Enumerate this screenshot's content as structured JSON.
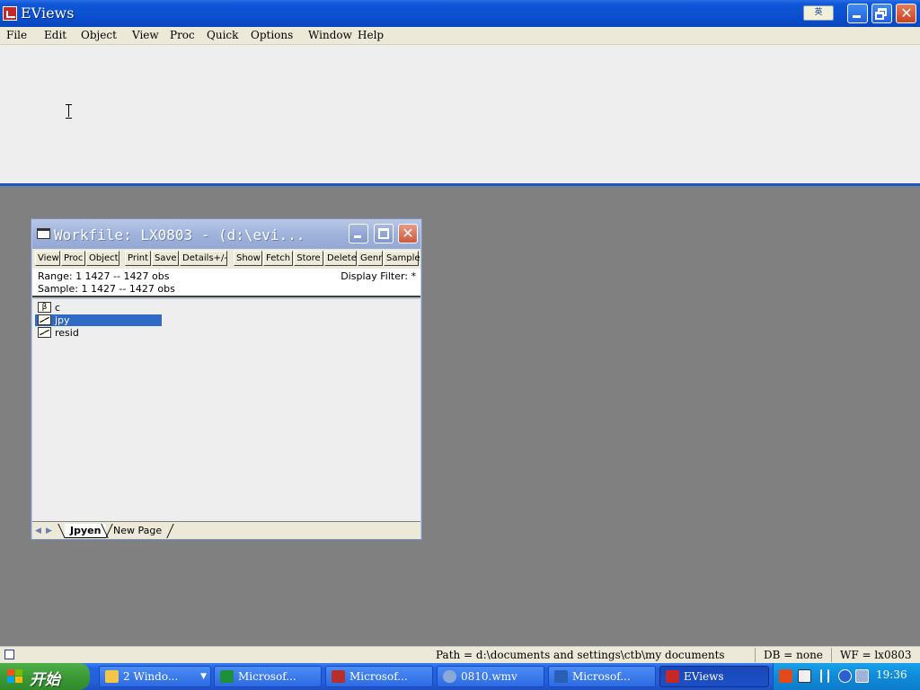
{
  "app": {
    "title": "EViews",
    "ime_badge": "英"
  },
  "menu": {
    "items": [
      {
        "label": "File"
      },
      {
        "label": "Edit"
      },
      {
        "label": "Object"
      },
      {
        "label": "View"
      },
      {
        "label": "Proc"
      },
      {
        "label": "Quick"
      },
      {
        "label": "Options"
      },
      {
        "label": "Window"
      },
      {
        "label": "Help"
      }
    ]
  },
  "workfile": {
    "title": "Workfile: LX0803 - (d:\\evi...",
    "toolbar": [
      "View",
      "Proc",
      "Object",
      "Print",
      "Save",
      "Details+/-",
      "Show",
      "Fetch",
      "Store",
      "Delete",
      "Genr",
      "Sample"
    ],
    "range": "Range:  1 1427  --  1427 obs",
    "sample": "Sample: 1 1427  --  1427 obs",
    "display_filter": "Display Filter: *",
    "objects": [
      {
        "name": "c",
        "icon": "coefficient-icon",
        "glyph": "β",
        "selected": false
      },
      {
        "name": "jpy",
        "icon": "series-icon",
        "glyph": "",
        "selected": true
      },
      {
        "name": "resid",
        "icon": "series-icon",
        "glyph": "",
        "selected": false
      }
    ],
    "tabs": [
      {
        "label": "Jpyen",
        "active": true
      },
      {
        "label": "New Page",
        "active": false
      }
    ]
  },
  "status": {
    "path": "Path = d:\\documents and settings\\ctb\\my documents",
    "db": "DB = none",
    "wf": "WF = lx0803"
  },
  "taskbar": {
    "start_label": "开始",
    "tasks": [
      {
        "label": "2 Windo...",
        "icon": "folder-icon",
        "color": "#f3c64a",
        "active": false,
        "group": true
      },
      {
        "label": "Microsof...",
        "icon": "excel-icon",
        "color": "#1f8f3a",
        "active": false,
        "group": false
      },
      {
        "label": "Microsof...",
        "icon": "access-icon",
        "color": "#b5302a",
        "active": false,
        "group": false
      },
      {
        "label": "0810.wmv",
        "icon": "media-player-icon",
        "color": "#8aa9d6",
        "active": false,
        "group": false
      },
      {
        "label": "Microsof...",
        "icon": "word-icon",
        "color": "#2b5fb3",
        "active": false,
        "group": false
      },
      {
        "label": "EViews",
        "icon": "eviews-icon",
        "color": "#c62828",
        "active": true,
        "group": false
      }
    ],
    "clock": "19:36"
  },
  "colors": {
    "titlebar": "#0a4fd0",
    "selection": "#316ac5",
    "desktop": "#808080",
    "taskbar": "#245edb",
    "start": "#3c9a36"
  }
}
